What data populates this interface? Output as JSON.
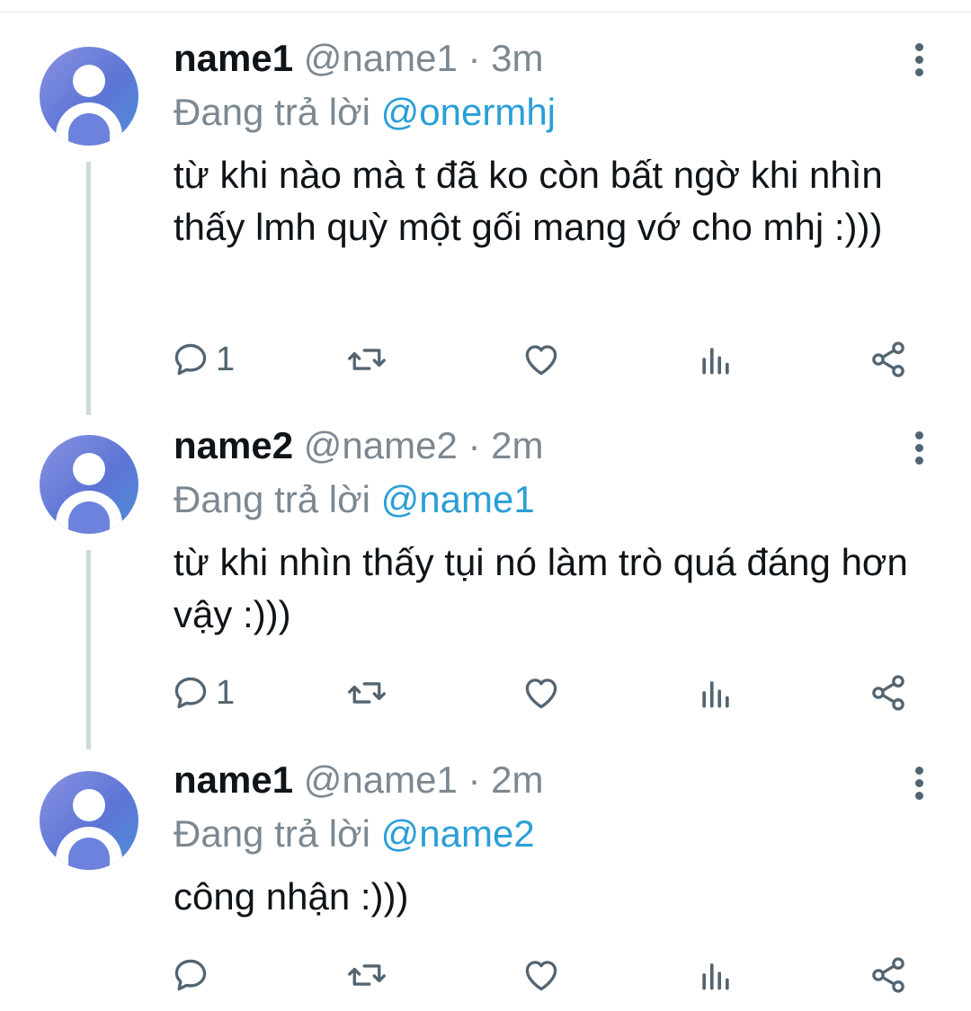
{
  "tweets": [
    {
      "display_name": "name1",
      "handle": "@name1",
      "separator": "·",
      "time": "3m",
      "reply_prefix": "Đang trả lời",
      "reply_to": "@onermhj",
      "text": "từ khi nào mà t đã ko còn bất ngờ khi nhìn thấy lmh quỳ một gối mang vớ cho mhj :)))",
      "reply_count": "1"
    },
    {
      "display_name": "name2",
      "handle": "@name2",
      "separator": "·",
      "time": "2m",
      "reply_prefix": "Đang trả lời",
      "reply_to": "@name1",
      "text": "từ khi nhìn thấy tụi nó làm trò quá đáng hơn vậy :)))",
      "reply_count": "1"
    },
    {
      "display_name": "name1",
      "handle": "@name1",
      "separator": "·",
      "time": "2m",
      "reply_prefix": "Đang trả lời",
      "reply_to": "@name2",
      "text": "công nhận :)))",
      "reply_count": ""
    }
  ],
  "icons": {
    "reply": "reply-icon",
    "retweet": "retweet-icon",
    "like": "heart-icon",
    "views": "views-icon",
    "share": "share-icon",
    "more": "more-options-icon"
  },
  "colors": {
    "link": "#2a9fd8",
    "muted": "#7c8891",
    "icon": "#536471",
    "thread_line": "#cfd9de"
  }
}
